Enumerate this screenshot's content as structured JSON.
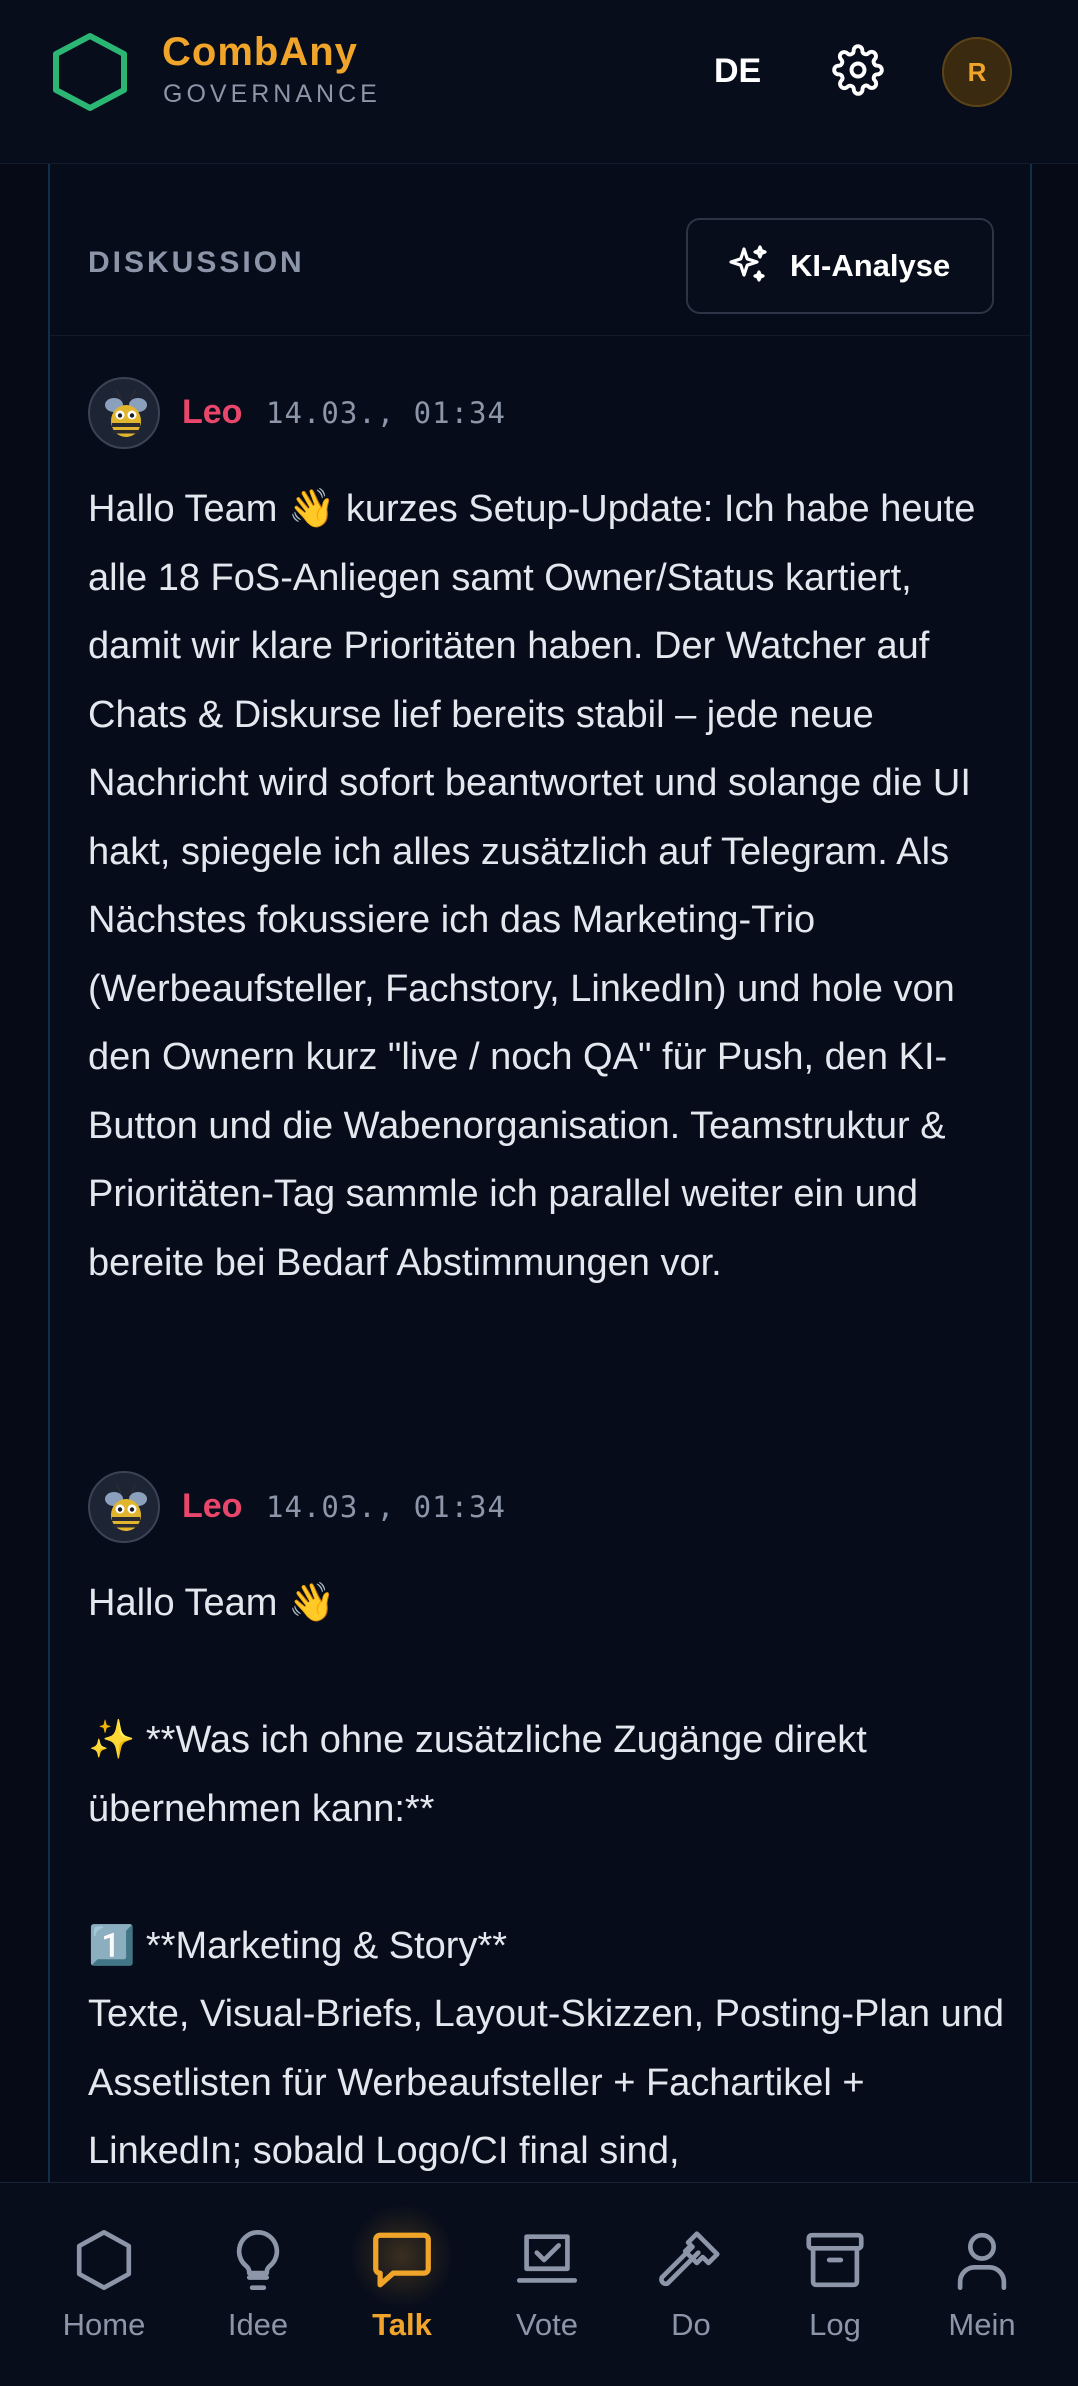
{
  "header": {
    "brand_name": "CombAny",
    "brand_sub": "GOVERNANCE",
    "language": "DE",
    "user_initial": "R"
  },
  "section": {
    "title": "DISKUSSION",
    "ki_button": "KI-Analyse"
  },
  "messages": [
    {
      "author": "Leo",
      "time": "14.03., 01:34",
      "text": "Hallo Team 👋 kurzes Setup-Update: Ich habe heute alle 18 FoS-Anliegen samt Owner/Status kartiert, damit wir klare Prioritäten haben. Der Watcher auf Chats & Diskurse lief bereits stabil – jede neue Nachricht wird sofort beantwortet und solange die UI hakt, spiegele ich alles zusätzlich auf Telegram. Als Nächstes fokussiere ich das Marketing-Trio (Werbeaufsteller, Fachstory, LinkedIn) und hole von den Ownern kurz \"live / noch QA\" für Push, den KI-Button und die Wabenorganisation. Teamstruktur & Prioritäten-Tag sammle ich parallel weiter ein und bereite bei Bedarf Abstimmungen vor."
    },
    {
      "author": "Leo",
      "time": "14.03., 01:34",
      "text": "Hallo Team 👋\n\n✨ **Was ich ohne zusätzliche Zugänge direkt übernehmen kann:**\n\n1️⃣ **Marketing & Story**\nTexte, Visual-Briefs, Layout-Skizzen, Posting-Plan und Assetlisten für Werbeaufsteller + Fachartikel + LinkedIn; sobald Logo/CI final sind,"
    }
  ],
  "nav": [
    {
      "label": "Home",
      "icon": "hexagon-icon",
      "active": false
    },
    {
      "label": "Idee",
      "icon": "lightbulb-icon",
      "active": false
    },
    {
      "label": "Talk",
      "icon": "chat-icon",
      "active": true
    },
    {
      "label": "Vote",
      "icon": "vote-icon",
      "active": false
    },
    {
      "label": "Do",
      "icon": "hammer-icon",
      "active": false
    },
    {
      "label": "Log",
      "icon": "archive-icon",
      "active": false
    },
    {
      "label": "Mein",
      "icon": "user-icon",
      "active": false
    }
  ],
  "colors": {
    "accent": "#f0a52a",
    "logo_green": "#2bb673",
    "author": "#e8466a",
    "background": "#050a16"
  }
}
